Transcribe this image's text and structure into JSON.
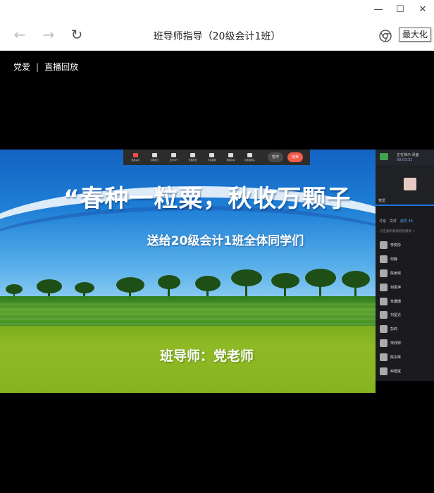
{
  "window": {
    "title": "班导师指导（20级会计1班）",
    "tooltip": "最大化",
    "controls": {
      "minimize": "—",
      "maximize": "☐",
      "close": "✕"
    }
  },
  "nav": {
    "back": "←",
    "forward": "→",
    "reload": "↻"
  },
  "breadcrumb": {
    "brand": "党爱",
    "separator": "|",
    "section": "直播回放"
  },
  "slide": {
    "title": "“春种一粒粟，秋收万颗子",
    "subtitle": "送给20级会计1班全体同学们",
    "teacher": "班导师：党老师"
  },
  "meeting_toolbar": {
    "tools": [
      "结束演示",
      "切换窗口",
      "显示PPT",
      "管理成员",
      "分享屏幕",
      "视频共享",
      "切换摄像头"
    ],
    "pause": "暂停",
    "end": "结束"
  },
  "side_panel": {
    "header_line1": "正在演示·桌面",
    "header_line2": "00:03:31",
    "video_name": "党爱",
    "tabs": [
      "讨论",
      "文件",
      "成员 46"
    ],
    "invite": "点击复制邀请链接邀请 +",
    "participants": [
      "李奕彤",
      "何静",
      "陈雨琪",
      "何思萍",
      "朱珊珊",
      "刘星达",
      "彭莉",
      "宋欣妍",
      "陈东晖",
      "仲霞斌"
    ]
  },
  "colors": {
    "end_button": "#f25a4a",
    "accent_blue": "#1a73e8",
    "slide_green": "#8fba25"
  }
}
